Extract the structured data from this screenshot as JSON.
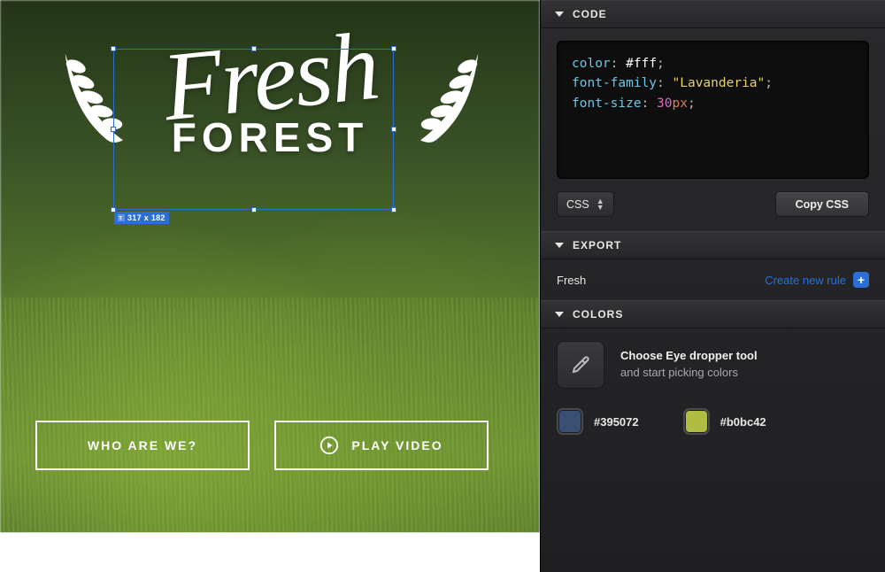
{
  "canvas": {
    "logo": {
      "top": "Fresh",
      "bottom": "FOREST"
    },
    "selection_badge": "317 x 182",
    "buttons": {
      "who": "WHO ARE WE?",
      "play": "PLAY VIDEO"
    }
  },
  "panel": {
    "code": {
      "title": "CODE",
      "lines": [
        {
          "prop": "color",
          "value_hex": "#fff"
        },
        {
          "prop": "font-family",
          "value_str": "\"Lavanderia\""
        },
        {
          "prop": "font-size",
          "value_num": "30",
          "value_unit": "px"
        }
      ],
      "format_select": "CSS",
      "copy_button": "Copy CSS"
    },
    "export": {
      "title": "EXPORT",
      "layer_name": "Fresh",
      "create_rule": "Create new rule"
    },
    "colors": {
      "title": "COLORS",
      "hint_bold": "Choose Eye dropper tool",
      "hint_rest": "and start picking colors",
      "swatches": [
        {
          "hex": "#395072"
        },
        {
          "hex": "#b0bc42"
        }
      ]
    }
  }
}
